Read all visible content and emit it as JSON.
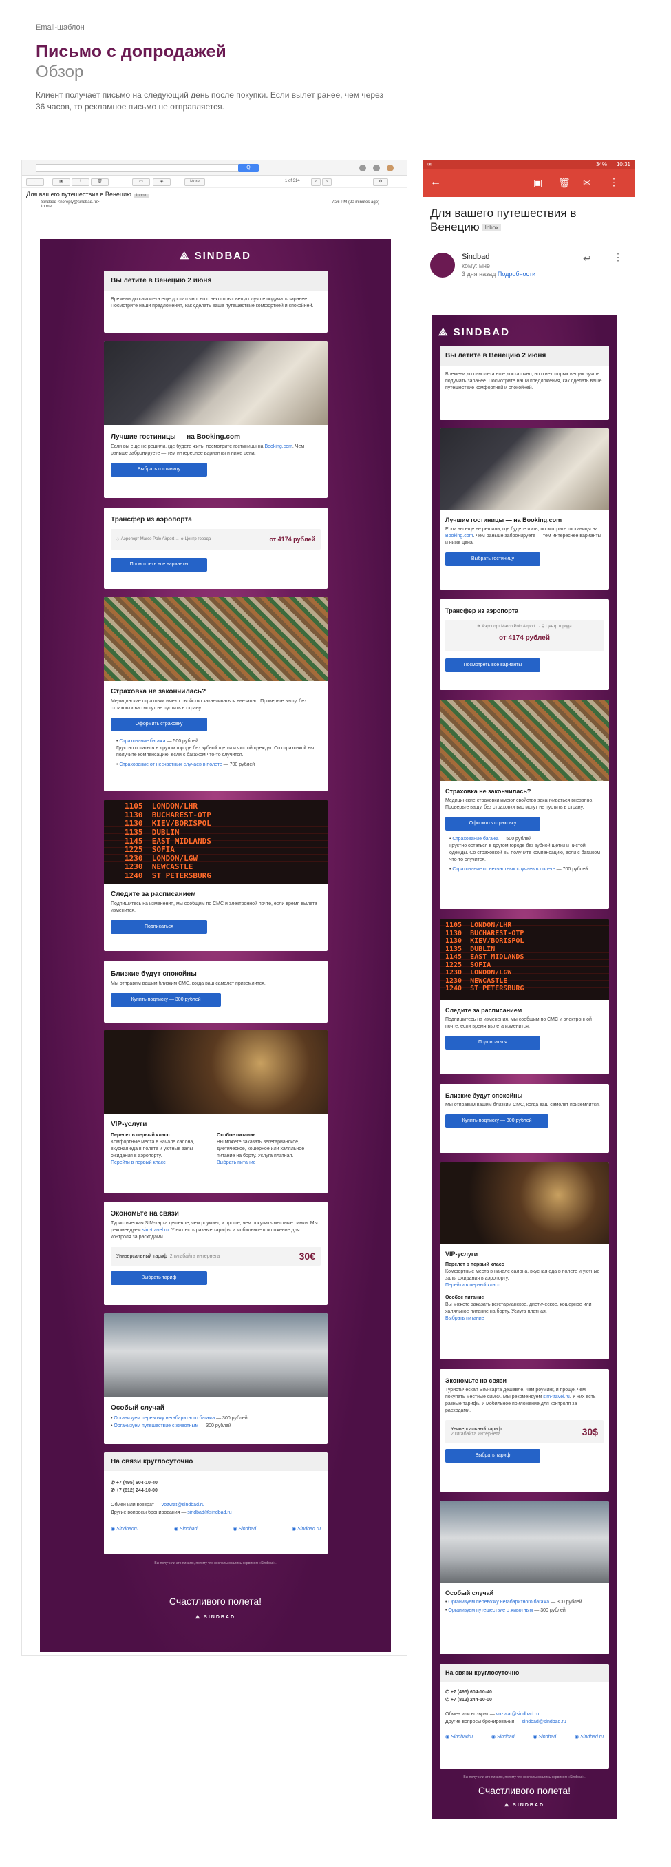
{
  "header": {
    "kicker": "Email-шаблон",
    "title": "Письмо с допродажей",
    "subtitle": "Обзор",
    "description": "Клиент получает письмо на следующий день после покупки. Если вылет ранее, чем через 36 часов, то рекламное письмо не отправляется."
  },
  "desktop": {
    "search_btn": "Q",
    "pager": "1 of 314",
    "subject": "Для вашего путешествия в Венецию",
    "subject_label": "Inbox",
    "from": "Sindbad <noreply@sindbad.ru>",
    "to": "to me",
    "date": "7:36 PM (20 minutes ago)",
    "toolbar": [
      "←",
      "▣",
      "!",
      "🗑",
      "▭",
      "◈",
      "More"
    ]
  },
  "mobile": {
    "status_time": "10:31",
    "status_battery": "34%",
    "subject": "Для вашего путешествия в Венецию",
    "subject_label": "Inbox",
    "sender": "Sindbad",
    "to": "кому: мне",
    "when": "3 дня назад",
    "details": "Подробности"
  },
  "email": {
    "logo": "SINDBAD",
    "flight": {
      "title": "Вы летите в Венецию 2 июня",
      "text": "Времени до самолета еще достаточно, но о некоторых вещах лучше подумать заранее. Посмотрите наши предложения, как сделать ваше путешествие комфортней и спокойней."
    },
    "hotels": {
      "title": "Лучшие гостиницы — на Booking.com",
      "text_pre": "Если вы еще не решили, где будете жить, посмотрите гостиницы на ",
      "link": "Booking.com",
      "text_post": ". Чем раньше забронируете — тем интереснее варианты и ниже цена.",
      "button": "Выбрать гостиницу"
    },
    "transfer": {
      "title": "Трансфер из аэропорта",
      "from": "Аэропорт Marco Polo Airport",
      "to": "Центр города",
      "price": "от 4174 рублей",
      "button": "Посмотреть все варианты"
    },
    "insurance": {
      "title": "Страховка не закончилась?",
      "text": "Медицинские страховки имеют свойство заканчиваться внезапно. Проверьте вашу, без страховки вас могут не пустить в страну.",
      "button": "Оформить страховку",
      "item1_link": "Страхование багажа",
      "item1_price": " — 500 рублей",
      "item1_text": "Грустно остаться в другом городе без зубной щетки и чистой одежды. Со страховкой вы получите компенсацию, если с багажом что-то случится.",
      "item2_link": "Страхование от несчастных случаев в полете",
      "item2_price": " — 700 рублей"
    },
    "schedule": {
      "title": "Следите за расписанием",
      "text": "Подпишитесь на изменения, мы сообщим по СМС и электронной почте, если время вылета изменится.",
      "button": "Подписаться",
      "board": "1105  LONDON/LHR\n1130  BUCHAREST-OTP\n1130  KIEV/BORISPOL\n1135  DUBLIN\n1145  EAST MIDLANDS\n1225  SOFIA\n1230  LONDON/LGW\n1230  NEWCASTLE\n1240  ST PETERSBURG"
    },
    "family": {
      "title": "Близкие будут спокойны",
      "text": "Мы отправим вашим близким СМС, когда ваш самолет приземлится.",
      "button": "Купить подписку — 300 рублей"
    },
    "vip": {
      "title": "VIP-услуги",
      "c1_title": "Перелет в первый класс",
      "c1_text": "Комфортные места в начале салона, вкусная еда в полете и уютные залы ожидания в аэропорту.",
      "c1_link": "Перейти в первый класс",
      "c2_title": "Особое питание",
      "c2_text": "Вы можете заказать вегетарианское, диетическое, кошерное или халяльное питание на борту. Услуга платная.",
      "c2_link": "Выбрать питание"
    },
    "sim": {
      "title": "Экономьте на связи",
      "text_pre": "Туристическая SIM-карта дешевле, чем роуминг, и проще, чем покупать местные симки. Мы рекомендуем ",
      "link": "sim-travel.ru",
      "text_post": ". У них есть разные тарифы и мобильное приложение для контроля за расходами.",
      "tariff": "Универсальный тариф",
      "tariff_sub": "2 гигабайта интернета",
      "price_desktop": "30€",
      "price_mobile": "30$",
      "button": "Выбрать тариф"
    },
    "special": {
      "title": "Особый случай",
      "item1": "Организуем перевозку негабаритного багажа",
      "item1_price": " — 300 рублей.",
      "item2": "Организуем путешествие с животным",
      "item2_price": " — 300 рублей"
    },
    "support": {
      "title": "На связи круглосуточно",
      "phone1": "+7 (495) 604-10-40",
      "phone2": "+7 (812) 244-10-00",
      "exchange": "Обмен или возврат — ",
      "exchange_mail": "vozvrat@sindbad.ru",
      "other": "Другие вопросы бронирования — ",
      "other_mail": "sindbad@sindbad.ru",
      "social": [
        "Sindbadru",
        "Sindbad",
        "Sindbad",
        "Sindbad.ru"
      ]
    },
    "disclaimer": "Вы получили это письмо, потому что воспользовались сервисом «Sindbad».",
    "farewell": "Счастливого полета!"
  }
}
